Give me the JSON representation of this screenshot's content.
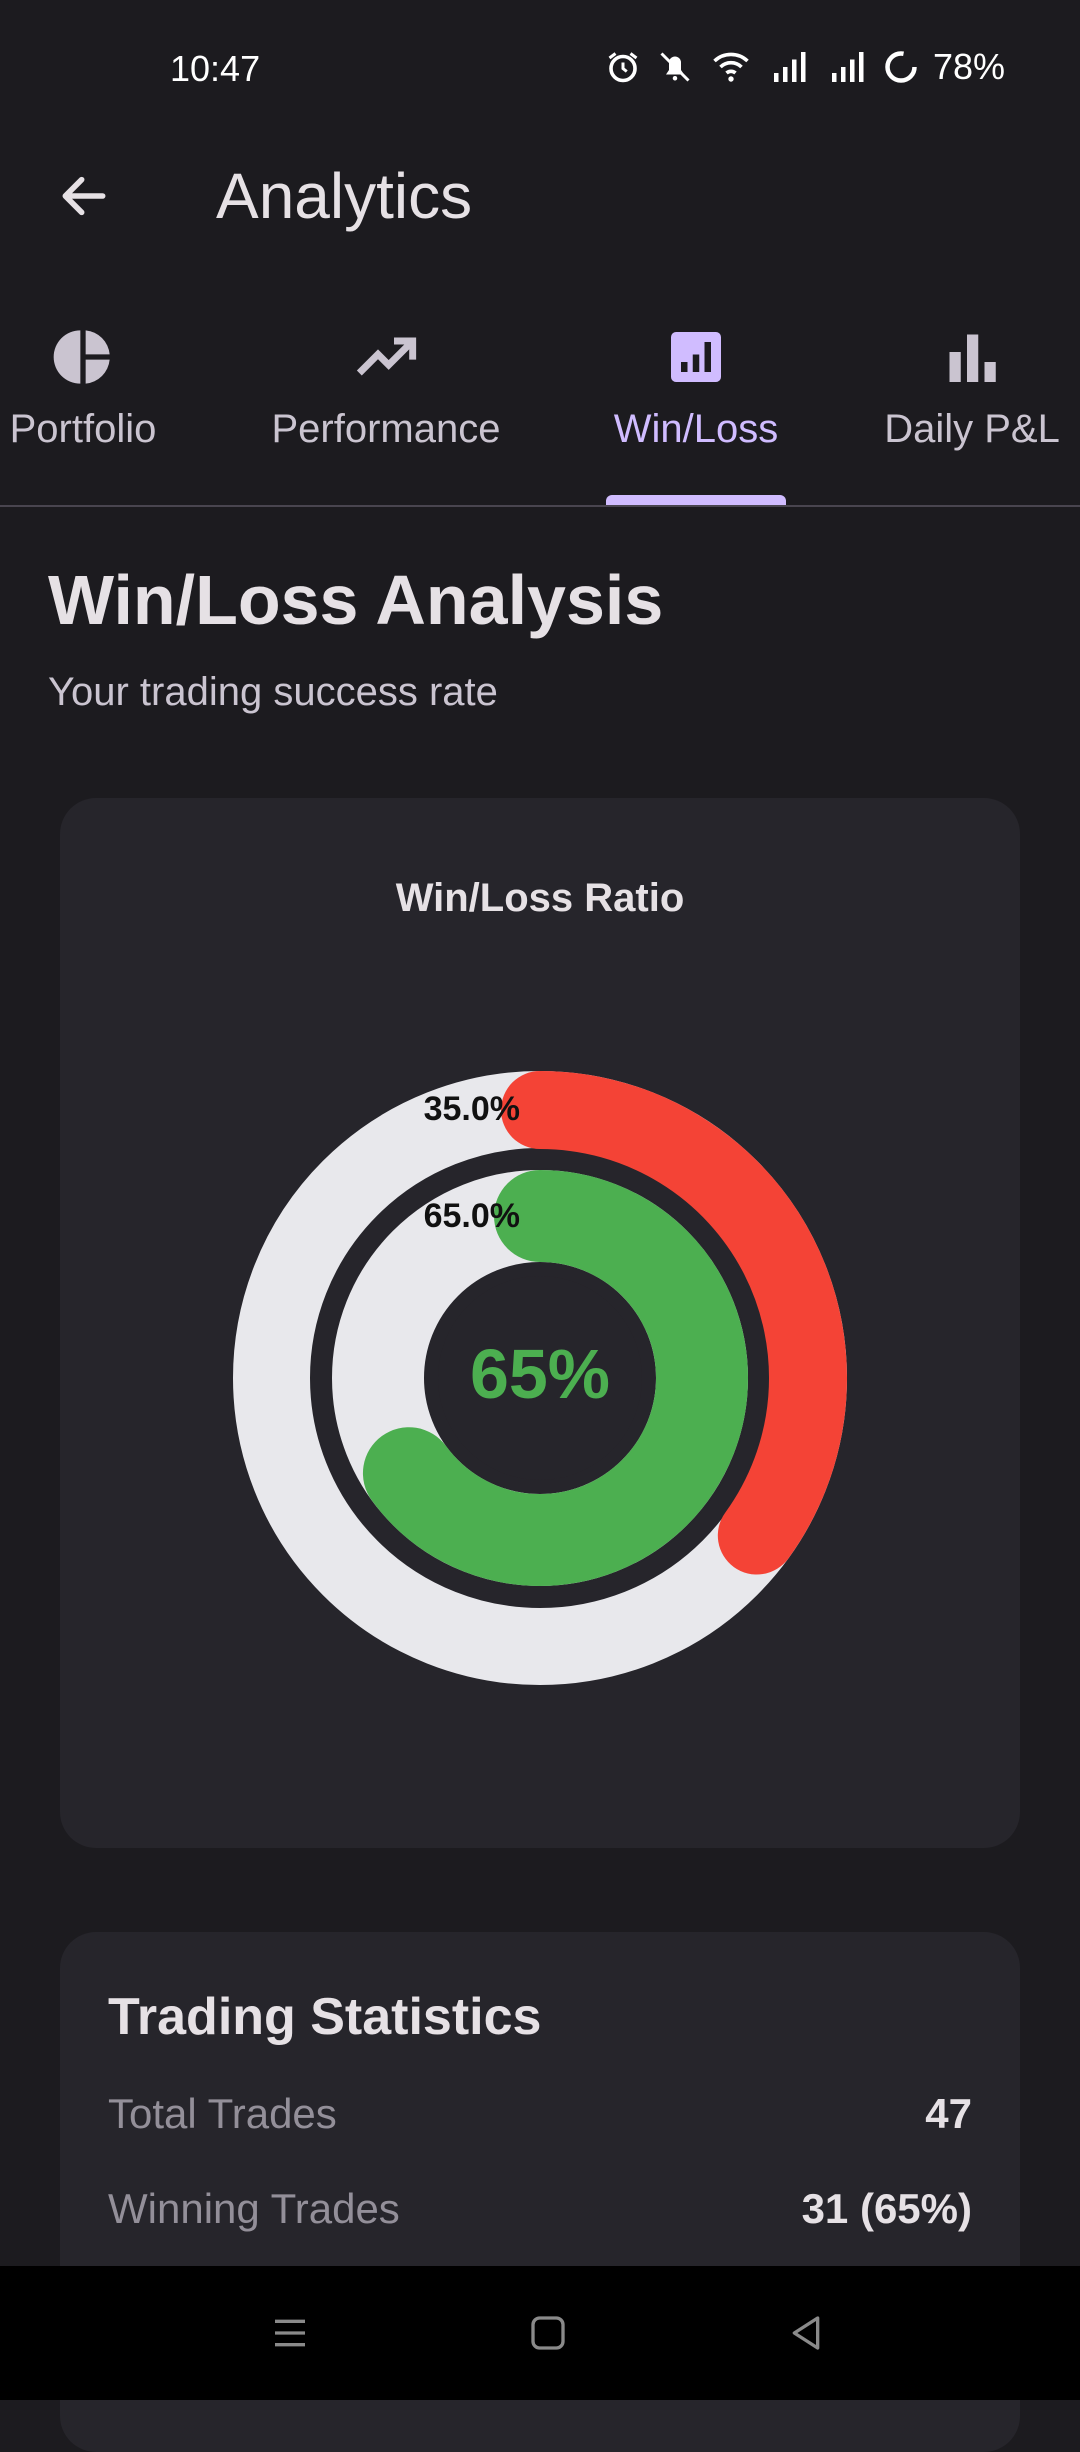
{
  "status_bar": {
    "time": "10:47",
    "battery": "78%"
  },
  "app_bar": {
    "title": "Analytics"
  },
  "tabs": [
    {
      "label": "Portfolio",
      "icon": "pie-chart-icon"
    },
    {
      "label": "Performance",
      "icon": "trending-up-icon"
    },
    {
      "label": "Win/Loss",
      "icon": "bar-chart-box-icon",
      "active": true
    },
    {
      "label": "Daily P&L",
      "icon": "bar-chart-icon"
    }
  ],
  "section": {
    "title": "Win/Loss Analysis",
    "subtitle": "Your trading success rate"
  },
  "chart_card": {
    "title": "Win/Loss Ratio",
    "center_label": "65%"
  },
  "chart_data": {
    "type": "pie",
    "title": "Win/Loss Ratio",
    "center_text": "65%",
    "rings": [
      {
        "value": 35.0,
        "label": "35.0%",
        "color": "#f44336"
      },
      {
        "value": 65.0,
        "label": "65.0%",
        "color": "#4caf50"
      }
    ],
    "track_color": "#e8e8ec"
  },
  "stats": {
    "title": "Trading Statistics",
    "rows": [
      {
        "label": "Total Trades",
        "value": "47"
      },
      {
        "label": "Winning Trades",
        "value": "31 (65%)"
      }
    ]
  },
  "colors": {
    "accent": "#d0bcff",
    "win": "#4caf50",
    "loss": "#f44336",
    "background": "#1c1b1f",
    "card": "#26252b"
  }
}
